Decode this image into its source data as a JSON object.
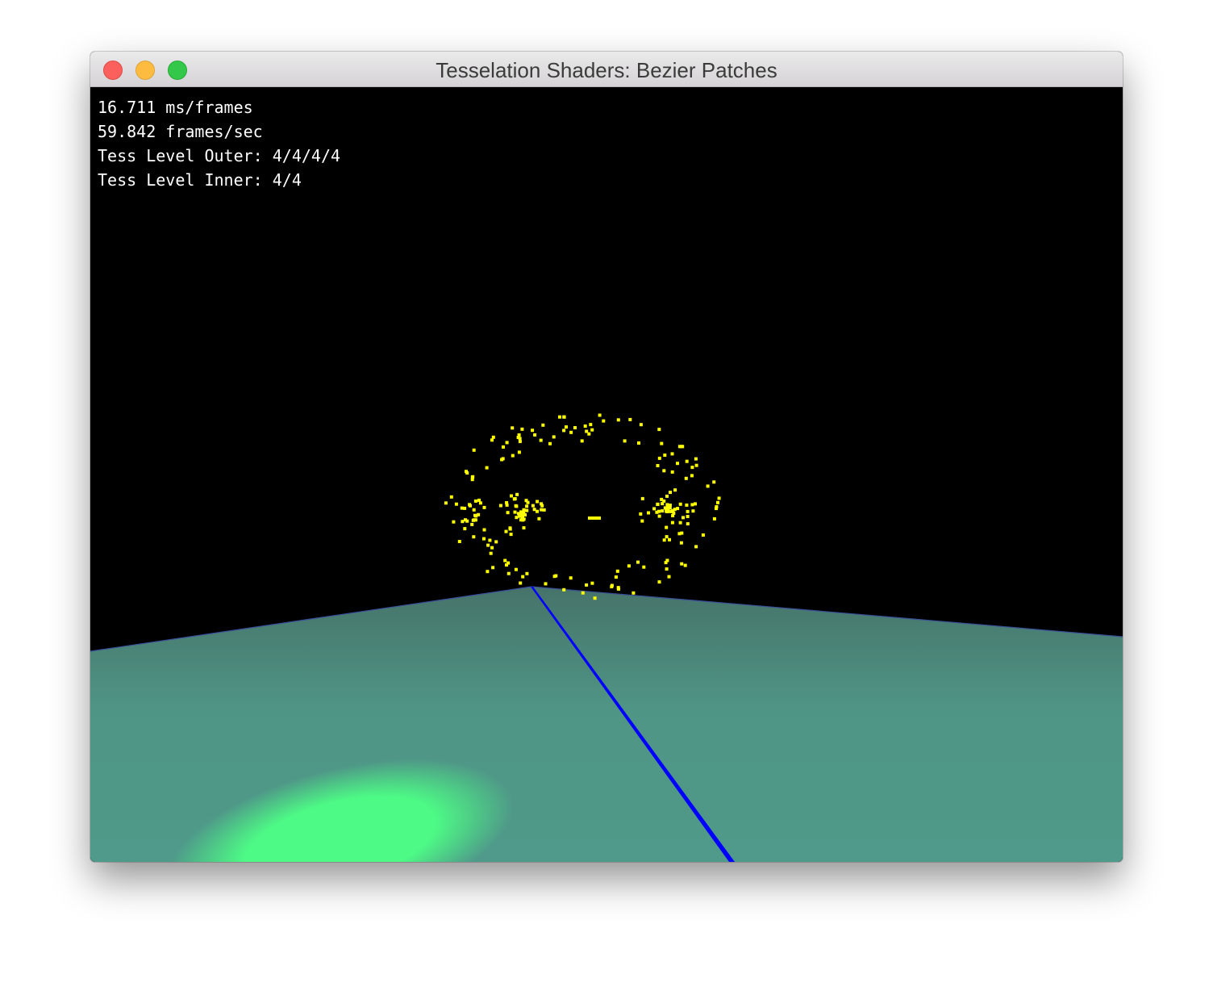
{
  "window": {
    "title": "Tesselation Shaders: Bezier Patches"
  },
  "overlay": {
    "ms_per_frame": "16.711 ms/frames",
    "fps": "59.842 frames/sec",
    "tess_outer": "Tess Level Outer: 4/4/4/4",
    "tess_inner": "Tess Level Inner: 4/4"
  },
  "scene": {
    "background_color": "#000000",
    "ground_color": "#4f9585",
    "ground_far_color": "#46736a",
    "light_spot_color": "#4dff85",
    "axis_line_color": "#0000ff",
    "control_point_color": "#ffff00"
  }
}
